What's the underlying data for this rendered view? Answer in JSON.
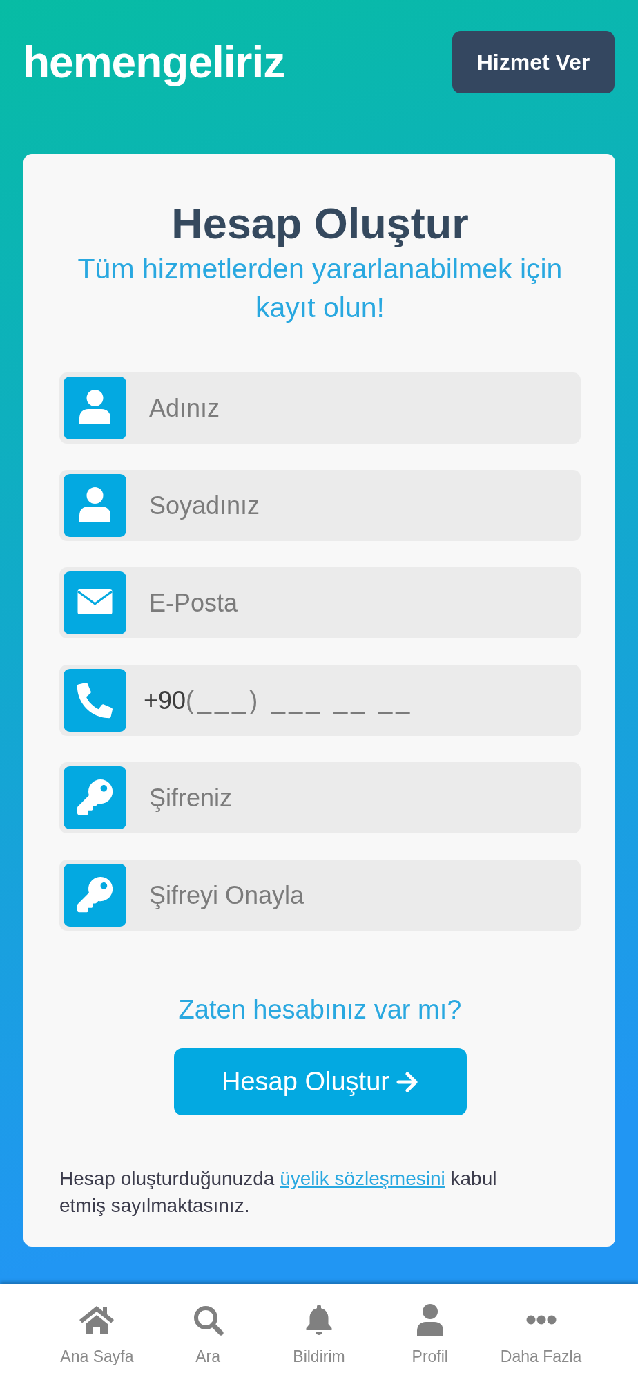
{
  "header": {
    "logo": "hemengeliriz",
    "button": "Hizmet Ver"
  },
  "form": {
    "title": "Hesap Oluştur",
    "subtitle": "Tüm hizmetlerden yararlanabilmek için kayıt olun!",
    "fields": [
      {
        "kind": "name",
        "placeholder": "Adınız"
      },
      {
        "kind": "name",
        "placeholder": "Soyadınız"
      },
      {
        "kind": "email",
        "placeholder": "E-Posta"
      },
      {
        "kind": "phone",
        "prefix": "+90",
        "placeholder": "(___) ___ __ __"
      },
      {
        "kind": "password",
        "placeholder": "Şifreniz"
      },
      {
        "kind": "password",
        "placeholder": "Şifreyi Onayla"
      }
    ],
    "login_link": "Zaten hesabınız var mı?",
    "submit_button": "Hesap Oluştur",
    "terms": {
      "before": "Hesap oluşturduğunuzda",
      "link": "üyelik sözleşmesini",
      "after": "kabul etmiş sayılmaktasınız."
    }
  },
  "bottom_nav": [
    {
      "kind": "home",
      "label": "Ana Sayfa"
    },
    {
      "kind": "search",
      "label": "Ara"
    },
    {
      "kind": "notifications",
      "label": "Bildirim"
    },
    {
      "kind": "profile",
      "label": "Profil"
    },
    {
      "kind": "more",
      "label": "Daha Fazla"
    }
  ]
}
